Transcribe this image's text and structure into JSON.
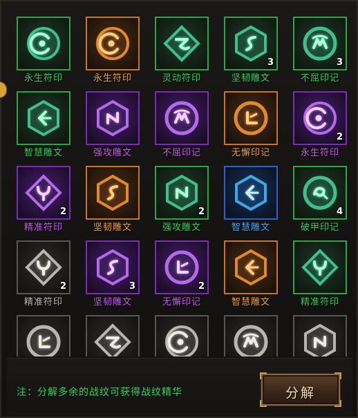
{
  "colors": {
    "green": "#2fd35a",
    "orange": "#f0a03a",
    "purple": "#c45cf0",
    "blue": "#4aa6f5",
    "white": "#bfbab2"
  },
  "grid": {
    "rows": [
      [
        {
          "name": "永生符印",
          "rarity": "green",
          "count": "",
          "shape": "circle",
          "symbol": "crescent-eye"
        },
        {
          "name": "永生符印",
          "rarity": "orange",
          "count": "",
          "shape": "circle",
          "symbol": "crescent-eye"
        },
        {
          "name": "灵动符印",
          "rarity": "green",
          "count": "",
          "shape": "diamond",
          "symbol": "wave-rune"
        },
        {
          "name": "坚韧雕文",
          "rarity": "green",
          "count": "3",
          "shape": "hexagon",
          "symbol": "s-rune"
        },
        {
          "name": "不屈印记",
          "rarity": "green",
          "count": "3",
          "shape": "round",
          "symbol": "m-rune"
        }
      ],
      [
        {
          "name": "智慧雕文",
          "rarity": "green",
          "count": "",
          "shape": "hexagon",
          "symbol": "arrow-rune"
        },
        {
          "name": "强攻雕文",
          "rarity": "purple",
          "count": "",
          "shape": "hexagon",
          "symbol": "n-rune"
        },
        {
          "name": "不屈印记",
          "rarity": "purple",
          "count": "",
          "shape": "round",
          "symbol": "m-rune"
        },
        {
          "name": "无懈印记",
          "rarity": "orange",
          "count": "",
          "shape": "round",
          "symbol": "l-rune"
        },
        {
          "name": "永生符印",
          "rarity": "purple",
          "count": "2",
          "shape": "circle",
          "symbol": "crescent-eye"
        }
      ],
      [
        {
          "name": "精准符印",
          "rarity": "purple",
          "count": "2",
          "shape": "diamond",
          "symbol": "fork-rune"
        },
        {
          "name": "坚韧雕文",
          "rarity": "orange",
          "count": "",
          "shape": "hexagon",
          "symbol": "s-rune"
        },
        {
          "name": "强攻雕文",
          "rarity": "green",
          "count": "2",
          "shape": "hexagon",
          "symbol": "n-rune"
        },
        {
          "name": "智慧雕文",
          "rarity": "blue",
          "count": "",
          "shape": "hexagon",
          "symbol": "arrow-rune"
        },
        {
          "name": "破甲印记",
          "rarity": "green",
          "count": "4",
          "shape": "round",
          "symbol": "swirl-rune"
        }
      ],
      [
        {
          "name": "精准符印",
          "rarity": "white",
          "count": "2",
          "shape": "diamond",
          "symbol": "fork-rune"
        },
        {
          "name": "坚韧雕文",
          "rarity": "purple",
          "count": "3",
          "shape": "hexagon",
          "symbol": "s-rune"
        },
        {
          "name": "无懈印记",
          "rarity": "purple",
          "count": "2",
          "shape": "round",
          "symbol": "l-rune"
        },
        {
          "name": "智慧雕文",
          "rarity": "orange",
          "count": "",
          "shape": "hexagon",
          "symbol": "arrow-rune"
        },
        {
          "name": "精准符印",
          "rarity": "green",
          "count": "",
          "shape": "diamond",
          "symbol": "fork-rune"
        }
      ],
      [
        {
          "name": "",
          "rarity": "white",
          "count": "",
          "shape": "round",
          "symbol": "l-rune"
        },
        {
          "name": "",
          "rarity": "white",
          "count": "",
          "shape": "diamond",
          "symbol": "wave-rune"
        },
        {
          "name": "",
          "rarity": "white",
          "count": "",
          "shape": "circle",
          "symbol": "crescent-eye"
        },
        {
          "name": "",
          "rarity": "white",
          "count": "",
          "shape": "round",
          "symbol": "m-rune"
        },
        {
          "name": "",
          "rarity": "white",
          "count": "",
          "shape": "hexagon",
          "symbol": "n-rune"
        }
      ]
    ]
  },
  "footer": {
    "note": "注：分解多余的战纹可获得战纹精华",
    "decompose_label": "分解"
  }
}
